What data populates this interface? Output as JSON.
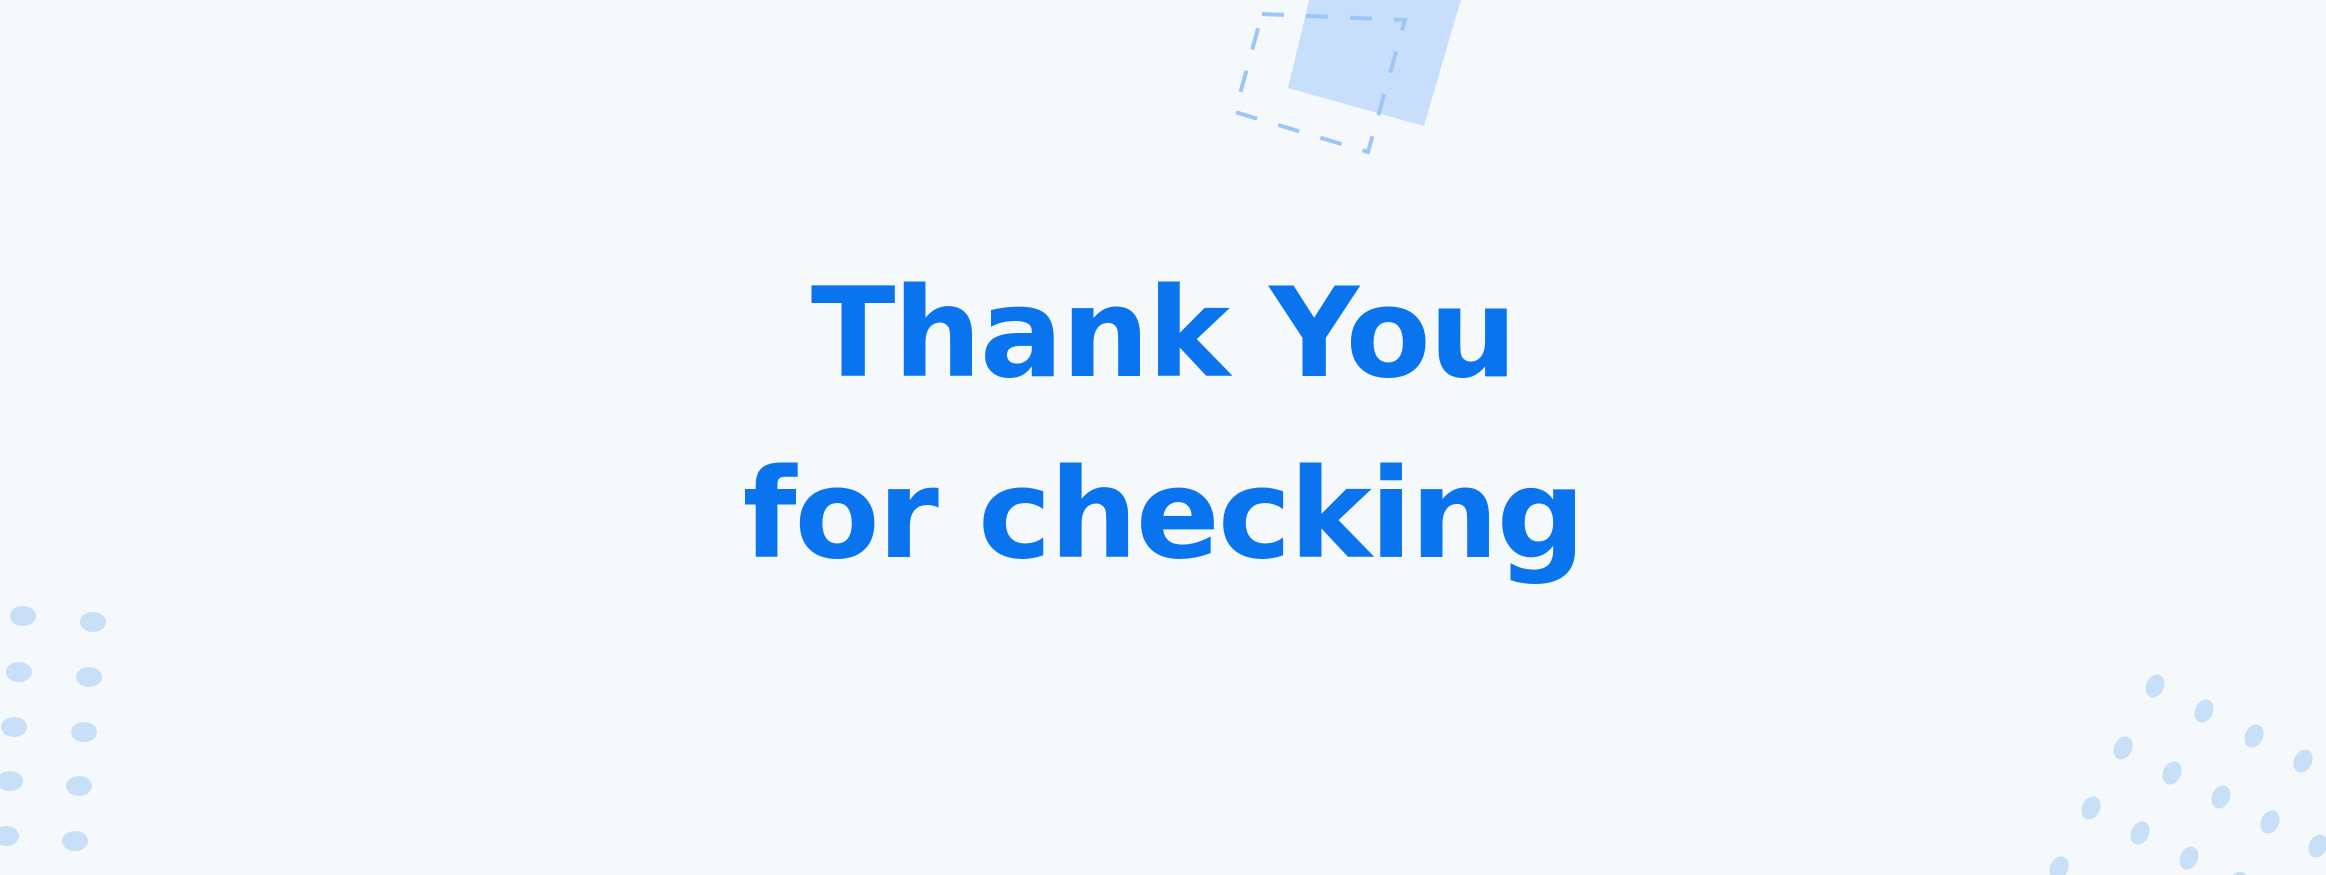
{
  "message": {
    "line1": "Thank You",
    "line2": "for checking"
  },
  "colors": {
    "background": "#f5f9fc",
    "text_accent": "#0a74ee",
    "decor_fill": "#c7dffb",
    "decor_stroke": "#9cc6f7",
    "decor_dots": "#c8dff8"
  },
  "icons": {
    "top_decoration": "tilted-square-with-dashed-outline",
    "left_decoration": "dot-grid",
    "right_decoration": "dot-grid"
  }
}
